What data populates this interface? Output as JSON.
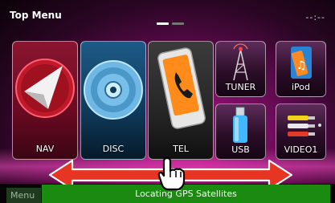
{
  "header": {
    "title": "Top Menu",
    "clock": "--:--",
    "pages": 2,
    "active_page": 1
  },
  "tiles": [
    {
      "id": "nav",
      "label": "NAV"
    },
    {
      "id": "disc",
      "label": "DISC"
    },
    {
      "id": "tel",
      "label": "TEL"
    },
    {
      "id": "tuner",
      "label": "TUNER"
    },
    {
      "id": "ipod",
      "label": "iPod"
    },
    {
      "id": "usb",
      "label": "USB"
    },
    {
      "id": "video1",
      "label": "VIDEO1"
    }
  ],
  "footer": {
    "menu_label": "Menu",
    "status": "Locating GPS Satellites"
  },
  "colors": {
    "background": "#6e0c5a",
    "status_bar": "#1b8a10",
    "arrow": "#e63522"
  },
  "gesture_hint": {
    "arrow": "double-headed-arrow",
    "hand": "swipe-hand"
  }
}
